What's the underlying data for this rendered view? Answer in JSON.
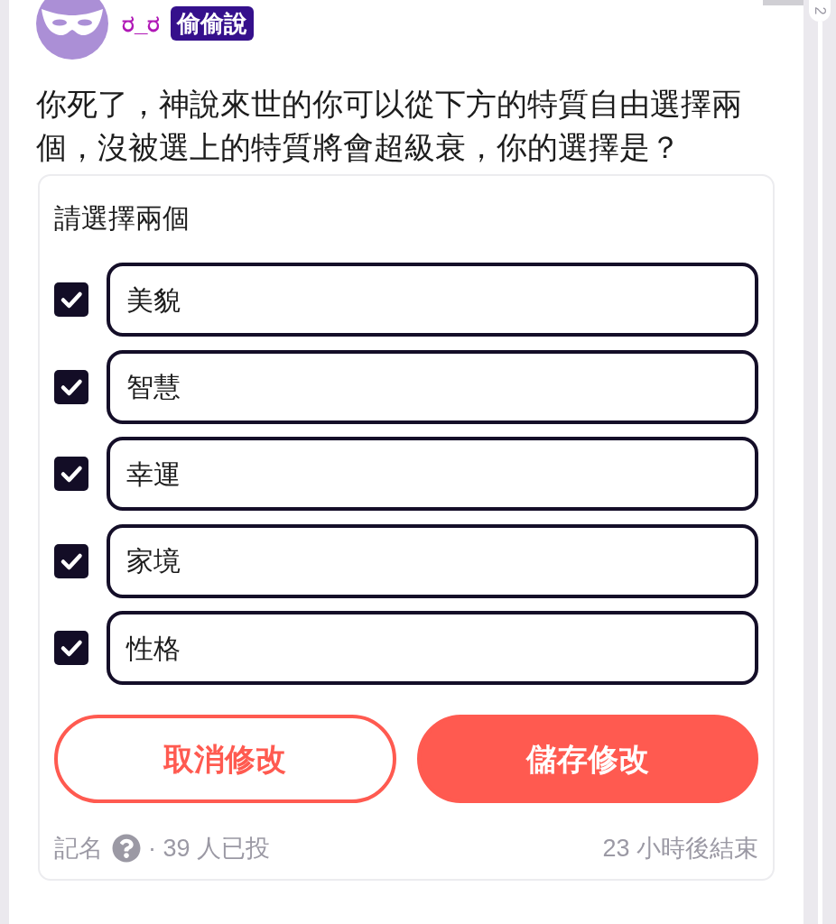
{
  "post": {
    "author": {
      "name": "ರ_ರ",
      "badge": "偷偷說"
    },
    "question": "你死了，神說來世的你可以從下方的特質自由選擇兩個，沒被選上的特質將會超級衰，你的選擇是？"
  },
  "poll": {
    "instruction": "請選擇兩個",
    "options": [
      {
        "label": "美貌",
        "checked": true
      },
      {
        "label": "智慧",
        "checked": true
      },
      {
        "label": "幸運",
        "checked": true
      },
      {
        "label": "家境",
        "checked": true
      },
      {
        "label": "性格",
        "checked": true
      }
    ],
    "buttons": [
      {
        "label": "取消修改",
        "kind": "secondary"
      },
      {
        "label": "儲存修改",
        "kind": "primary"
      }
    ],
    "footer": {
      "visibility": "記名",
      "votes": "· 39 人已投",
      "ends": "23 小時後結束"
    }
  },
  "side_rail": {
    "page": "2"
  }
}
